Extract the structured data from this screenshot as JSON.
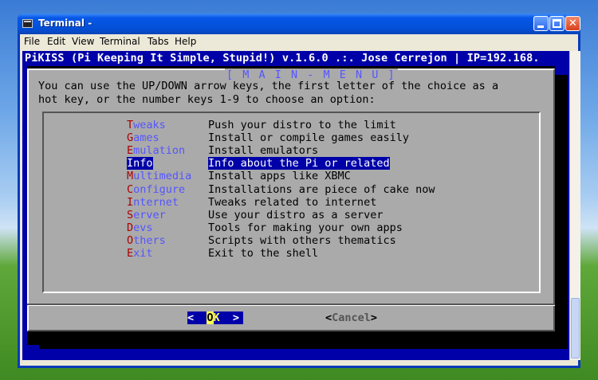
{
  "window": {
    "title": "Terminal -",
    "menu": [
      "File",
      "Edit",
      "View",
      "Terminal",
      "Tabs",
      "Help"
    ],
    "close_glyph": "✕"
  },
  "terminal": {
    "header": "PiKISS (Pi Keeping It Simple, Stupid!) v.1.6.0 .:. Jose Cerrejon | IP=192.168.",
    "dialog_title": "[ M A I N - M E N U ]",
    "instruction_lines": [
      "You can use the UP/DOWN arrow keys, the first letter of the choice as a",
      "hot key, or the number keys 1-9 to choose an option:"
    ],
    "menu_items": [
      {
        "hotkey": "T",
        "rest": "weaks",
        "desc": "Push your distro to the limit",
        "selected": false
      },
      {
        "hotkey": "G",
        "rest": "ames",
        "desc": "Install or compile games easily",
        "selected": false
      },
      {
        "hotkey": "E",
        "rest": "mulation",
        "desc": "Install emulators",
        "selected": false
      },
      {
        "hotkey": "I",
        "rest": "nfo",
        "desc": "Info about the Pi or related",
        "selected": true
      },
      {
        "hotkey": "M",
        "rest": "ultimedia",
        "desc": "Install apps like XBMC",
        "selected": false
      },
      {
        "hotkey": "C",
        "rest": "onfigure",
        "desc": "Installations are piece of cake now",
        "selected": false
      },
      {
        "hotkey": "I",
        "rest": "nternet",
        "desc": "Tweaks related to internet",
        "selected": false
      },
      {
        "hotkey": "S",
        "rest": "erver",
        "desc": "Use your distro as a server",
        "selected": false
      },
      {
        "hotkey": "D",
        "rest": "evs",
        "desc": "Tools for making your own apps",
        "selected": false
      },
      {
        "hotkey": "O",
        "rest": "thers",
        "desc": "Scripts with others thematics",
        "selected": false
      },
      {
        "hotkey": "E",
        "rest": "xit",
        "desc": "Exit to the shell",
        "selected": false
      }
    ],
    "ok_button": {
      "left": "<  ",
      "hotkey": "O",
      "rest": "K",
      "right": "  >"
    },
    "cancel_button": {
      "left": "<",
      "hotkey": "C",
      "rest": "ancel",
      "right": ">"
    }
  }
}
